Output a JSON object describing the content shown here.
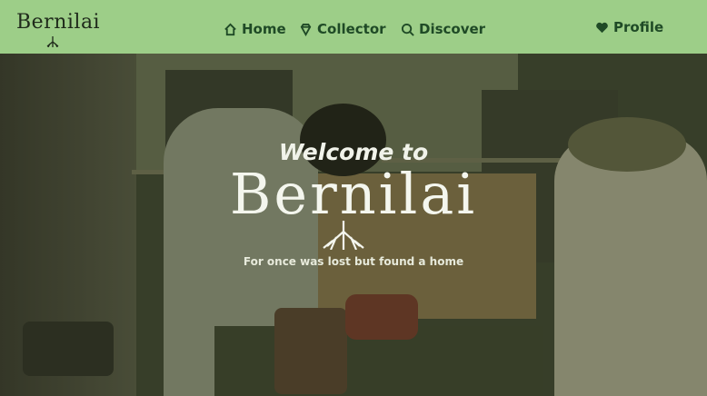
{
  "nav": {
    "logo": "Bernilai",
    "items": [
      {
        "label": "Home",
        "icon": "home-icon"
      },
      {
        "label": "Collector",
        "icon": "gem-icon"
      },
      {
        "label": "Discover",
        "icon": "search-icon"
      },
      {
        "label": "Profile",
        "icon": "heart-icon"
      }
    ]
  },
  "hero": {
    "welcome": "Welcome to",
    "title": "Bernilai",
    "tagline": "For once was lost but found a home"
  },
  "colors": {
    "nav_bg": "#9dce88",
    "nav_text": "#1f4a26",
    "hero_text": "#f4f6ee"
  }
}
